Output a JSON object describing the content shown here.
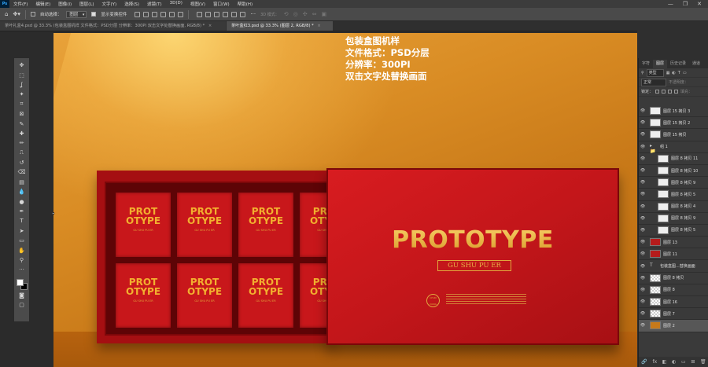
{
  "app": {
    "logo": "Ps"
  },
  "menubar": {
    "items": [
      "文件(F)",
      "编辑(E)",
      "图像(I)",
      "图层(L)",
      "文字(Y)",
      "选择(S)",
      "滤镜(T)",
      "3D(D)",
      "视图(V)",
      "窗口(W)",
      "帮助(H)"
    ]
  },
  "window_controls": {
    "minimize": "—",
    "maximize": "❐",
    "close": "✕"
  },
  "options": {
    "auto_select_label": "自动选择：",
    "auto_select_value": "图层",
    "show_transform_label": "显示变换控件",
    "mode3d": "3D 模式："
  },
  "tabs": [
    {
      "label": "茶叶礼盒4.psd @ 33.3% (包装盒图机样 文件格式：PSD分层 分辨率：300PI 双击文字处替换画面, RGB/8) *",
      "active": false
    },
    {
      "label": "茶叶盒红3.psd @ 33.3% (图层 2, RGB/8) *",
      "active": true
    }
  ],
  "canvas_text": {
    "line1": "包装盒图机样",
    "line2": "文件格式：PSD分层",
    "line3": "分辨率：300PI",
    "line4": "双击文字处替换画面"
  },
  "product": {
    "tile_title_1": "PROT",
    "tile_title_2": "OTYPE",
    "tile_sub": "GU SHU PU ER",
    "lid_title": "PROTOTYPE",
    "lid_sub": "GU SHU PU ER",
    "seal": "CHUN XIANG"
  },
  "tools": [
    "move-icon",
    "marquee-icon",
    "lasso-icon",
    "magic-wand-icon",
    "crop-icon",
    "frame-icon",
    "eyedropper-icon",
    "healing-icon",
    "brush-icon",
    "stamp-icon",
    "history-brush-icon",
    "eraser-icon",
    "gradient-icon",
    "blur-icon",
    "dodge-icon",
    "pen-icon",
    "type-icon",
    "path-select-icon",
    "shape-icon",
    "hand-icon",
    "zoom-icon",
    "more-icon"
  ],
  "tool_glyphs": [
    "✥",
    "⬚",
    "ʆ",
    "✦",
    "⌗",
    "⊠",
    "✎",
    "✚",
    "✏",
    "⎍",
    "↺",
    "⌫",
    "▤",
    "💧",
    "●",
    "✒",
    "T",
    "➤",
    "▭",
    "✋",
    "⚲",
    "···"
  ],
  "panel": {
    "tabs": [
      "字符",
      "图层",
      "历史记录",
      "通道"
    ],
    "kind_label": "类型",
    "blend_mode": "正常",
    "opacity_label": "不透明度：",
    "lock_label": "锁定：",
    "fill_label": "填充："
  },
  "layers": [
    {
      "name": "图层 15 拷贝 3",
      "thumb": "so",
      "indent": 0,
      "sel": false
    },
    {
      "name": "图层 15 拷贝 2",
      "thumb": "so",
      "indent": 0,
      "sel": false
    },
    {
      "name": "图层 15 拷贝",
      "thumb": "so",
      "indent": 0,
      "sel": false
    },
    {
      "name": "组 1",
      "thumb": "folder",
      "indent": 0,
      "sel": false
    },
    {
      "name": "图层 8 拷贝 11",
      "thumb": "so",
      "indent": 1,
      "sel": false
    },
    {
      "name": "图层 8 拷贝 10",
      "thumb": "so",
      "indent": 1,
      "sel": false
    },
    {
      "name": "图层 8 拷贝 9",
      "thumb": "so",
      "indent": 1,
      "sel": false
    },
    {
      "name": "图层 8 拷贝 5",
      "thumb": "so",
      "indent": 1,
      "sel": false
    },
    {
      "name": "图层 8 拷贝 4",
      "thumb": "so",
      "indent": 1,
      "sel": false
    },
    {
      "name": "图层 8 拷贝 9",
      "thumb": "so",
      "indent": 1,
      "sel": false
    },
    {
      "name": "图层 8 拷贝 5",
      "thumb": "so",
      "indent": 1,
      "sel": false
    },
    {
      "name": "图层 13",
      "thumb": "red",
      "indent": 0,
      "sel": false
    },
    {
      "name": "图层 11",
      "thumb": "red",
      "indent": 0,
      "sel": false
    },
    {
      "name": "包装盒图...替换画面",
      "thumb": "text",
      "indent": 0,
      "sel": false
    },
    {
      "name": "图层 8 拷贝",
      "thumb": "checker",
      "indent": 0,
      "sel": false
    },
    {
      "name": "图层 8",
      "thumb": "checker",
      "indent": 0,
      "sel": false
    },
    {
      "name": "图层 16",
      "thumb": "checker",
      "indent": 0,
      "sel": false
    },
    {
      "name": "图层 7",
      "thumb": "checker",
      "indent": 0,
      "sel": false
    },
    {
      "name": "图层 2",
      "thumb": "orange",
      "indent": 0,
      "sel": true
    }
  ],
  "panel_footer": [
    "link-icon",
    "fx-icon",
    "mask-icon",
    "adjustment-icon",
    "group-icon",
    "new-layer-icon",
    "trash-icon"
  ],
  "panel_footer_glyphs": [
    "🔗",
    "fx",
    "◧",
    "◐",
    "▭",
    "⊞",
    "🗑"
  ],
  "colors": {
    "accent_red": "#c8171b",
    "gold": "#f2b02f",
    "background_orange": "#d98c24"
  }
}
